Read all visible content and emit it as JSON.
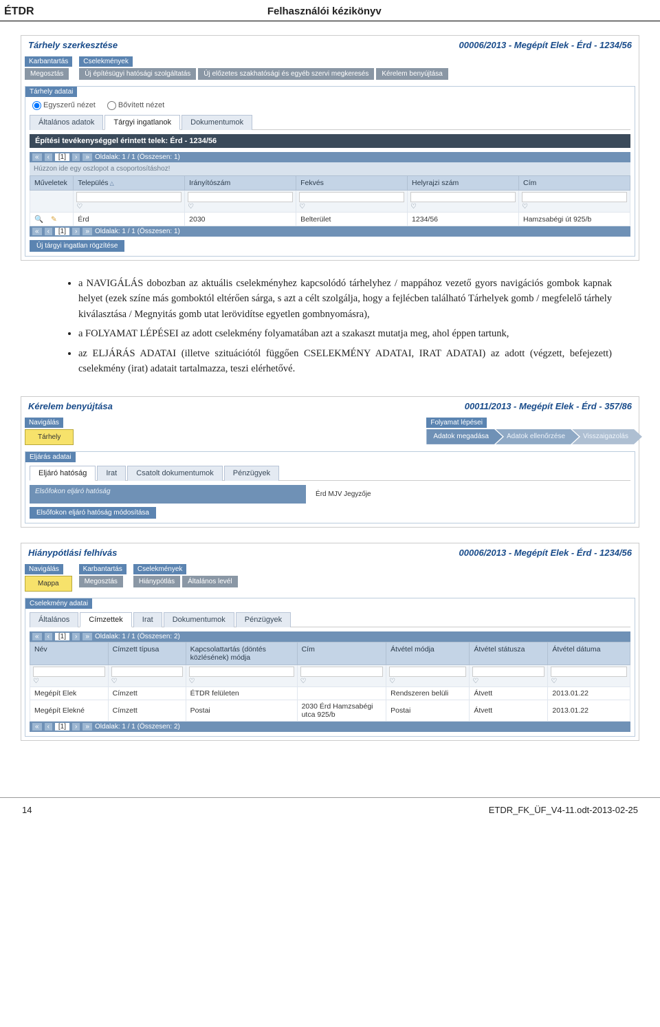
{
  "header": {
    "left": "ÉTDR",
    "center": "Felhasználói kézikönyv"
  },
  "section1": {
    "title": "Tárhely szerkesztése",
    "ref": "00006/2013 - Megépít Elek - Érd - 1234/56",
    "groups": {
      "karbantartas": "Karbantartás",
      "cselekmenyek": "Cselekmények",
      "tarhely_adatai": "Tárhely adatai"
    },
    "buttons": {
      "megosztas": "Megosztás",
      "uj_ep": "Új építésügyi hatósági szolgáltatás",
      "uj_eloz": "Új előzetes szakhatósági és egyéb szervi megkeresés",
      "kerelem": "Kérelem benyújtása"
    },
    "radio": {
      "simple": "Egyszerű nézet",
      "ext": "Bővített nézet"
    },
    "tabs": {
      "alt": "Általános adatok",
      "targyi": "Tárgyi ingatlanok",
      "dok": "Dokumentumok"
    },
    "strip": "Építési tevékenységgel érintett telek: Érd - 1234/56",
    "pager": {
      "pages": "Oldalak: 1 / 1 (Összesen: 1)",
      "num": "[1]"
    },
    "hint": "Húzzon ide egy oszlopot a csoportosításhoz!",
    "table": {
      "headers": [
        "Műveletek",
        "Település",
        "Irányítószám",
        "Fekvés",
        "Helyrajzi szám",
        "Cím"
      ],
      "row": {
        "telepules": "Érd",
        "irsz": "2030",
        "fekves": "Belterület",
        "hrsz": "1234/56",
        "cim": "Hamzsabégi út 925/b"
      }
    },
    "new_btn": "Új tárgyi ingatlan rögzítése"
  },
  "bodytext": {
    "li1a": "a N",
    "li1sc": "AVIGÁLÁS",
    "li1b": " dobozban az aktuális cselekményhez kapcsolódó tárhelyhez / mappához vezető gyors navigációs gombok kapnak helyet (ezek színe más gomboktól eltérően sárga, s azt a célt szolgálja, hogy a fejlécben található Tárhelyek gomb / megfelelő tárhely kiválasztása / Megnyitás gomb utat lerövidítse egyetlen gombnyomásra),",
    "li2a": "a F",
    "li2sc": "OLYAMAT LÉPÉSEI",
    "li2b": " az adott cselekmény folyamatában azt a szakaszt mutatja meg, ahol éppen tartunk,",
    "li3a": "az E",
    "li3sc1": "LJÁRÁS ADATAI",
    "li3b": " (illetve szituációtól függően C",
    "li3sc2": "SELEKMÉNY ADATAI",
    "li3c": ", I",
    "li3sc3": "RAT ADATAI",
    "li3d": ") az adott (végzett, befejezett) cselekmény (irat) adatait tartalmazza, teszi elérhetővé."
  },
  "section2": {
    "title": "Kérelem benyújtása",
    "ref": "00011/2013 - Megépít Elek - Érd - 357/86",
    "groups": {
      "nav": "Navigálás",
      "steps": "Folyamat lépései",
      "eljaras": "Eljárás adatai"
    },
    "buttons": {
      "tarhely": "Tárhely"
    },
    "steps": {
      "s1": "Adatok megadása",
      "s2": "Adatok ellenőrzése",
      "s3": "Visszaigazolás"
    },
    "tabs": {
      "t1": "Eljáró hatóság",
      "t2": "Irat",
      "t3": "Csatolt dokumentumok",
      "t4": "Pénzügyek"
    },
    "row_label": "Elsőfokon eljáró hatóság",
    "row_val": "Érd MJV Jegyzője",
    "mod_btn": "Elsőfokon eljáró hatóság módosítása"
  },
  "section3": {
    "title": "Hiánypótlási felhívás",
    "ref": "00006/2013 - Megépít Elek - Érd - 1234/56",
    "groups": {
      "nav": "Navigálás",
      "karb": "Karbantartás",
      "csel": "Cselekmények",
      "csadatai": "Cselekmény adatai"
    },
    "buttons": {
      "mappa": "Mappa",
      "megosztas": "Megosztás",
      "hianypotlas": "Hiánypótlás",
      "altlevel": "Általános levél"
    },
    "tabs": {
      "t1": "Általános",
      "t2": "Címzettek",
      "t3": "Irat",
      "t4": "Dokumentumok",
      "t5": "Pénzügyek"
    },
    "pager": {
      "pages": "Oldalak: 1 / 1 (Összesen: 2)",
      "num": "[1]"
    },
    "table": {
      "headers": [
        "Név",
        "Címzett típusa",
        "Kapcsolattartás (döntés közlésének) módja",
        "Cím",
        "Átvétel módja",
        "Átvétel státusza",
        "Átvétel dátuma"
      ],
      "rows": [
        {
          "nev": "Megépít Elek",
          "tipus": "Címzett",
          "kapcs": "ÉTDR felületen",
          "cim": "",
          "atvmod": "Rendszeren belüli",
          "atvstat": "Átvett",
          "atvdat": "2013.01.22"
        },
        {
          "nev": "Megépít Elekné",
          "tipus": "Címzett",
          "kapcs": "Postai",
          "cim": "2030 Érd Hamzsabégi utca 925/b",
          "atvmod": "Postai",
          "atvstat": "Átvett",
          "atvdat": "2013.01.22"
        }
      ]
    }
  },
  "footer": {
    "page": "14",
    "file": "ETDR_FK_ÜF_V4-11.odt-2013-02-25"
  }
}
